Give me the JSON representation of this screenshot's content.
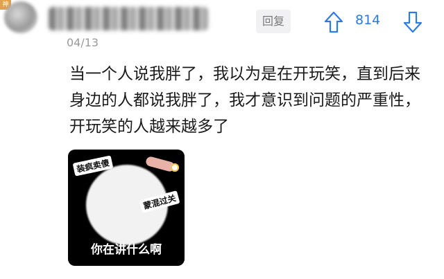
{
  "header": {
    "badge": "神",
    "date": "04/13"
  },
  "actions": {
    "reply_label": "回复",
    "upvote_icon": "arrow-up-icon",
    "vote_count": "814",
    "downvote_icon": "arrow-down-icon",
    "accent_color": "#2c7be5"
  },
  "comment": {
    "text": "当一个人说我胖了，我以为是在开玩笑，直到后来身边的人都说我胖了，我才意识到问题的严重性，开玩笑的人越来越多了"
  },
  "meme": {
    "sticker_1": "装疯卖傻",
    "sticker_2": "蒙混过关",
    "caption": "你在讲什么啊"
  }
}
